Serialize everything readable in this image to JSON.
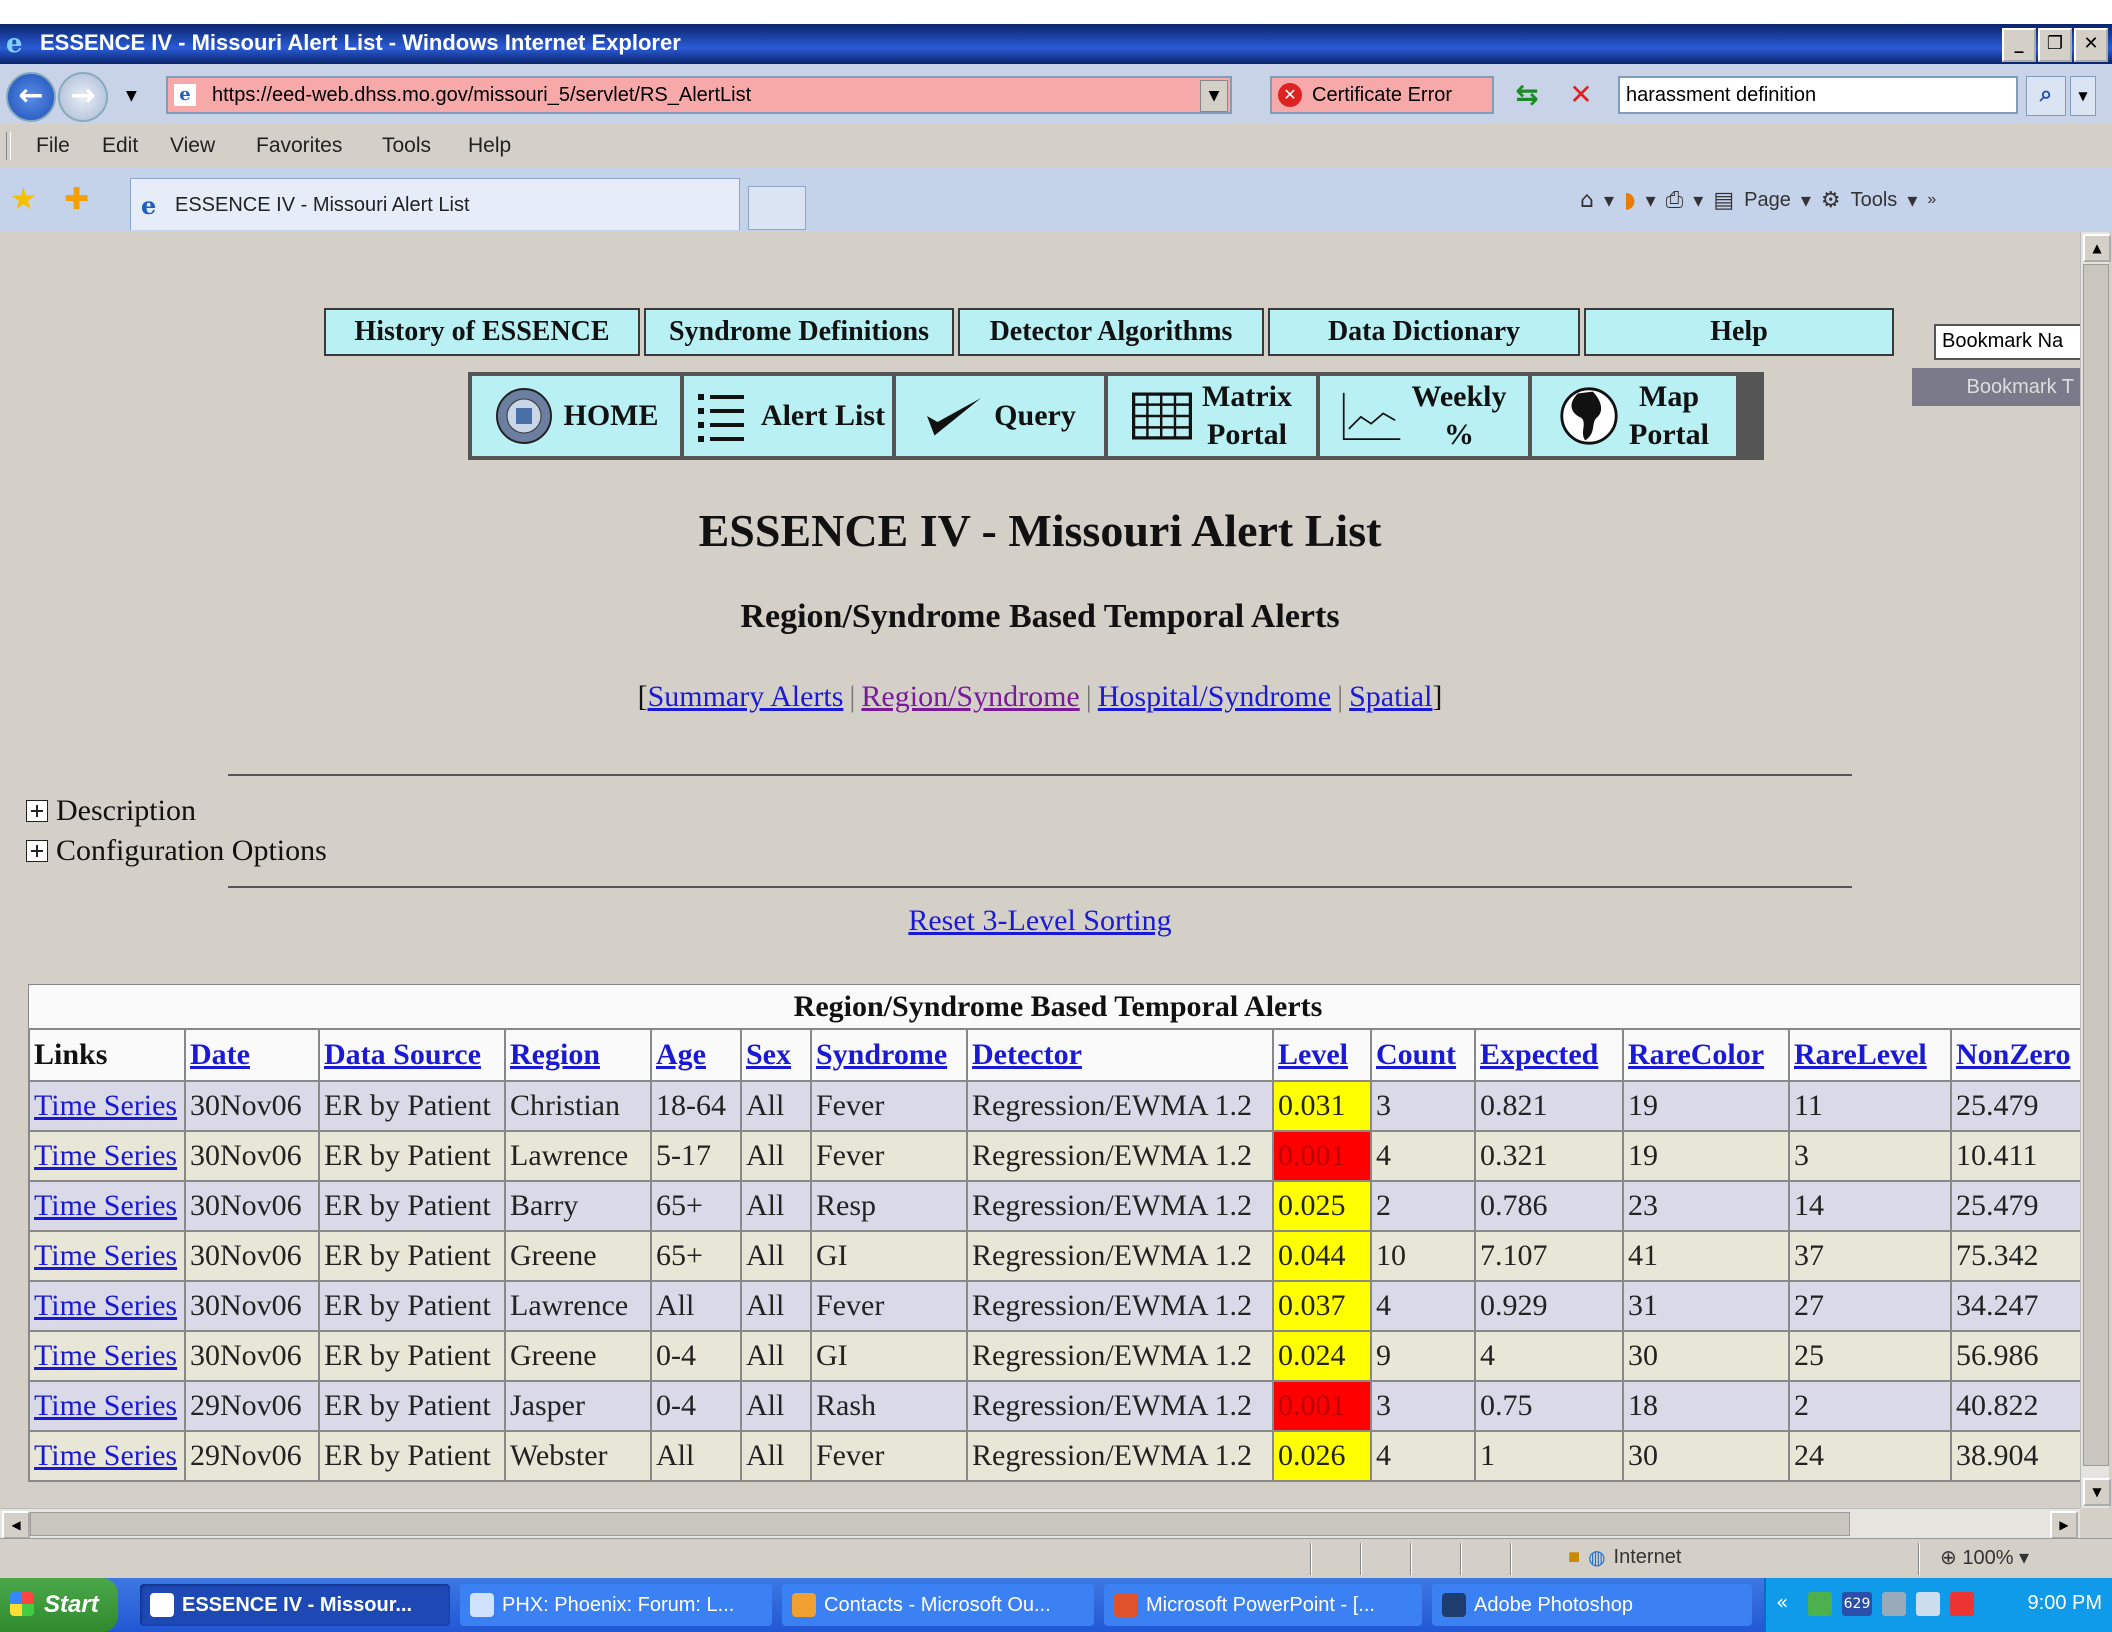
{
  "window": {
    "title": "ESSENCE IV - Missouri Alert List - Windows Internet Explorer"
  },
  "address": {
    "url": "https://eed-web.dhss.mo.gov/missouri_5/servlet/RS_AlertList",
    "cert_error": "Certificate Error"
  },
  "search": {
    "value": "harassment definition"
  },
  "menu": [
    "File",
    "Edit",
    "View",
    "Favorites",
    "Tools",
    "Help"
  ],
  "tab": {
    "title": "ESSENCE IV - Missouri Alert List"
  },
  "commandbar": {
    "page": "Page",
    "tools": "Tools"
  },
  "nav_top": [
    "History of ESSENCE",
    "Syndrome Definitions",
    "Detector Algorithms",
    "Data Dictionary",
    "Help"
  ],
  "bookmark": {
    "input": "Bookmark Na",
    "button": "Bookmark T"
  },
  "nav_icons": {
    "home": "HOME",
    "alert_list": "Alert List",
    "query": "Query",
    "matrix_1": "Matrix",
    "matrix_2": "Portal",
    "weekly_1": "Weekly",
    "weekly_2": "%",
    "map_1": "Map",
    "map_2": "Portal"
  },
  "page": {
    "title": "ESSENCE IV - Missouri Alert List",
    "subtitle": "Region/Syndrome Based Temporal Alerts",
    "links": {
      "open": "[",
      "summary": "Summary Alerts",
      "region": "Region/Syndrome",
      "hospital": "Hospital/Syndrome",
      "spatial": "Spatial",
      "close": "]"
    },
    "description": "Description",
    "config": "Configuration Options",
    "reset": "Reset 3-Level Sorting"
  },
  "table": {
    "caption": "Region/Syndrome Based Temporal Alerts",
    "headers": [
      "Links",
      "Date",
      "Data Source",
      "Region",
      "Age",
      "Sex",
      "Syndrome",
      "Detector",
      "Level",
      "Count",
      "Expected",
      "RareColor",
      "RareLevel",
      "NonZero"
    ],
    "rows": [
      [
        "Time Series",
        "30Nov06",
        "ER by Patient",
        "Christian",
        "18-64",
        "All",
        "Fever",
        "Regression/EWMA 1.2",
        "0.031",
        "3",
        "0.821",
        "19",
        "11",
        "25.479"
      ],
      [
        "Time Series",
        "30Nov06",
        "ER by Patient",
        "Lawrence",
        "5-17",
        "All",
        "Fever",
        "Regression/EWMA 1.2",
        "0.001",
        "4",
        "0.321",
        "19",
        "3",
        "10.411"
      ],
      [
        "Time Series",
        "30Nov06",
        "ER by Patient",
        "Barry",
        "65+",
        "All",
        "Resp",
        "Regression/EWMA 1.2",
        "0.025",
        "2",
        "0.786",
        "23",
        "14",
        "25.479"
      ],
      [
        "Time Series",
        "30Nov06",
        "ER by Patient",
        "Greene",
        "65+",
        "All",
        "GI",
        "Regression/EWMA 1.2",
        "0.044",
        "10",
        "7.107",
        "41",
        "37",
        "75.342"
      ],
      [
        "Time Series",
        "30Nov06",
        "ER by Patient",
        "Lawrence",
        "All",
        "All",
        "Fever",
        "Regression/EWMA 1.2",
        "0.037",
        "4",
        "0.929",
        "31",
        "27",
        "34.247"
      ],
      [
        "Time Series",
        "30Nov06",
        "ER by Patient",
        "Greene",
        "0-4",
        "All",
        "GI",
        "Regression/EWMA 1.2",
        "0.024",
        "9",
        "4",
        "30",
        "25",
        "56.986"
      ],
      [
        "Time Series",
        "29Nov06",
        "ER by Patient",
        "Jasper",
        "0-4",
        "All",
        "Rash",
        "Regression/EWMA 1.2",
        "0.001",
        "3",
        "0.75",
        "18",
        "2",
        "40.822"
      ],
      [
        "Time Series",
        "29Nov06",
        "ER by Patient",
        "Webster",
        "All",
        "All",
        "Fever",
        "Regression/EWMA 1.2",
        "0.026",
        "4",
        "1",
        "30",
        "24",
        "38.904"
      ]
    ],
    "level_colors": [
      "yellow",
      "red",
      "yellow",
      "yellow",
      "yellow",
      "yellow",
      "red",
      "yellow"
    ],
    "color_hex": {
      "yellow": "#ffff00",
      "red": "#ff0000"
    }
  },
  "status": {
    "zone": "Internet",
    "zoom": "100%"
  },
  "taskbar": {
    "start": "Start",
    "tasks": [
      "ESSENCE IV - Missour...",
      "PHX: Phoenix: Forum: L...",
      "Contacts - Microsoft Ou...",
      "Microsoft PowerPoint - [...",
      "Adobe Photoshop"
    ],
    "tray_badge": "629",
    "clock": "9:00 PM"
  }
}
